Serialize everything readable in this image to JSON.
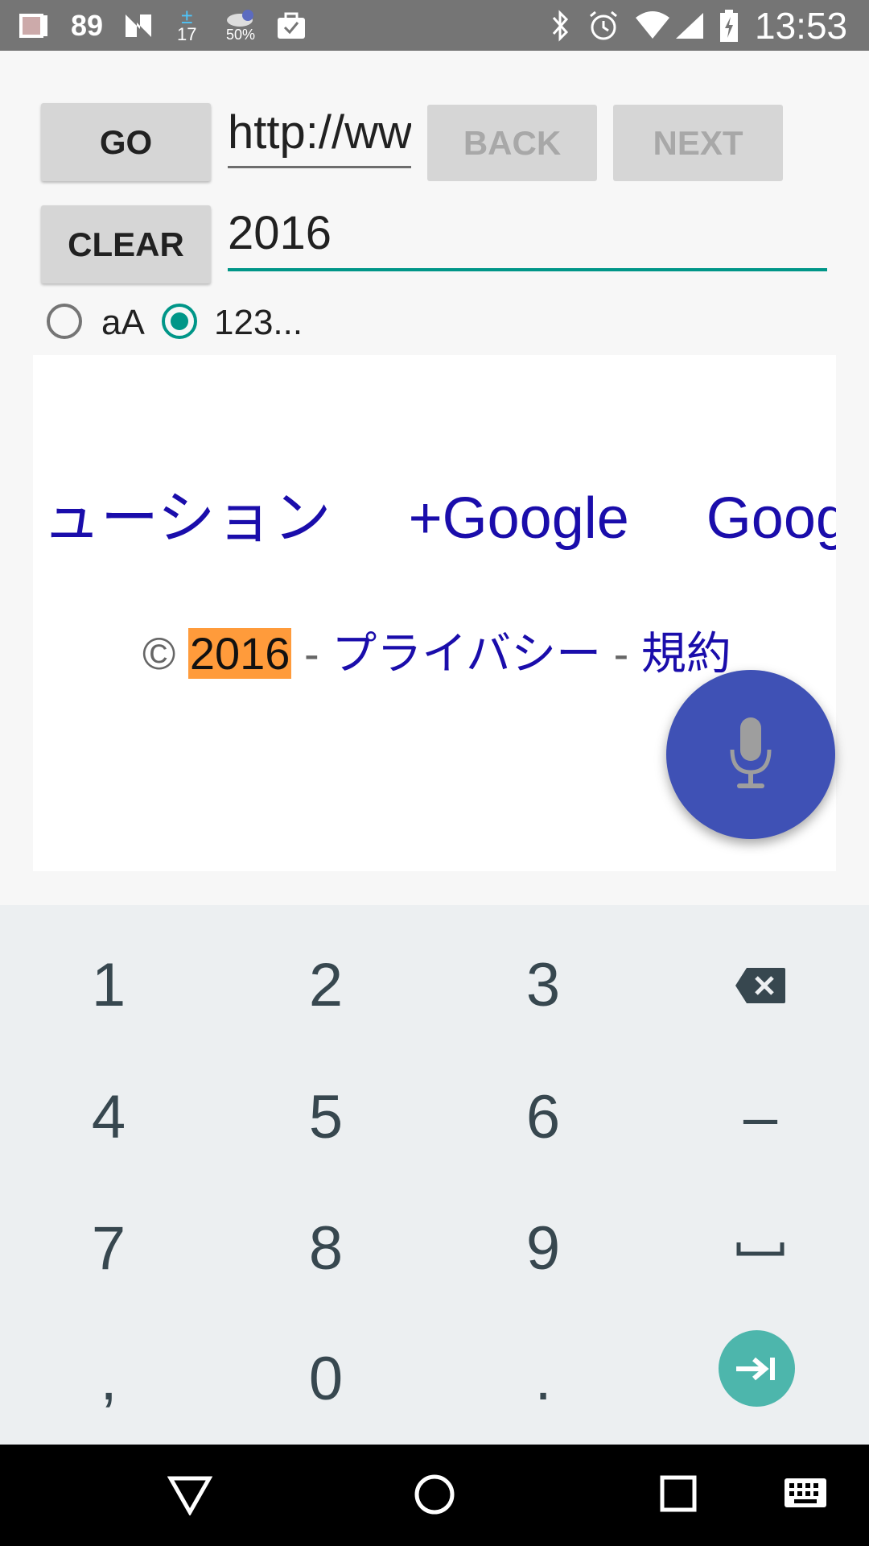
{
  "status_bar": {
    "battery_indicator_text": "89",
    "calendar_text": "17",
    "weather_percent": "50%",
    "time": "13:53",
    "left_icons": [
      "notebook-icon",
      "n-icon",
      "calendar-icon",
      "weather-icon",
      "briefcase-icon"
    ],
    "right_icons": [
      "bluetooth-icon",
      "alarm-icon",
      "wifi-icon",
      "signal-icon",
      "battery-icon"
    ]
  },
  "controls": {
    "go_label": "GO",
    "url_value": "http://ww",
    "back_label": "BACK",
    "next_label": "NEXT",
    "clear_label": "CLEAR",
    "search_value": "2016"
  },
  "radios": {
    "option_case_label": "aA",
    "option_number_label": "123...",
    "selected": "123..."
  },
  "webpage": {
    "nav_links": [
      "ューション",
      "+Google",
      "Goog"
    ],
    "copyright_symbol": "©",
    "highlight_year": "2016",
    "separator": "-",
    "privacy_link": "プライバシー",
    "terms_link": "規約"
  },
  "keyboard": {
    "rows": [
      [
        "1",
        "2",
        "3",
        "backspace"
      ],
      [
        "4",
        "5",
        "6",
        "–"
      ],
      [
        "7",
        "8",
        "9",
        "␣"
      ],
      [
        ",",
        "0",
        ".",
        "enter"
      ]
    ]
  },
  "colors": {
    "accent": "#009688",
    "link": "#1a0dab",
    "highlight": "#ff9b3b",
    "fab": "#3f51b5",
    "enter_key": "#4db6ac"
  }
}
